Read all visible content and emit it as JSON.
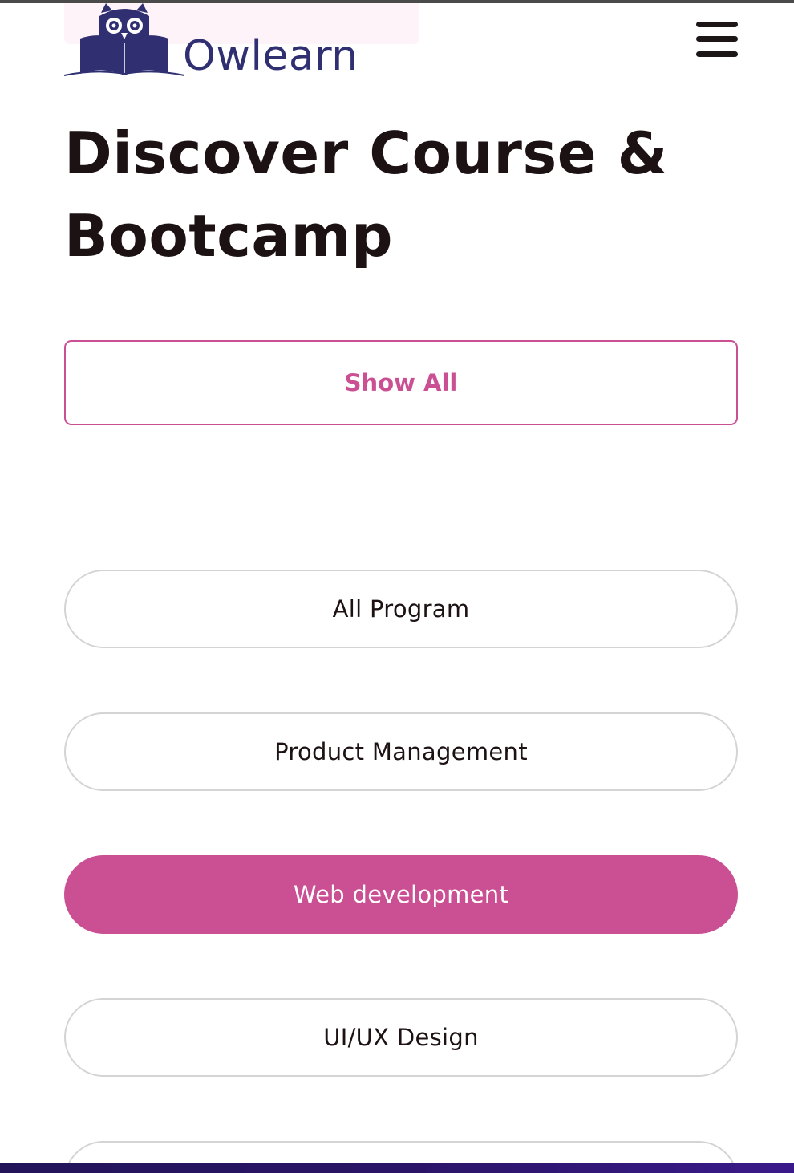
{
  "header": {
    "brand_name": "Owlearn",
    "menu_icon": "hamburger-menu-icon"
  },
  "hero": {
    "title_line1": "Discover Course &",
    "title_line2": "Bootcamp"
  },
  "filters": {
    "show_all_label": "Show All",
    "categories": [
      {
        "label": "All Program",
        "active": false
      },
      {
        "label": "Product Management",
        "active": false
      },
      {
        "label": "Web development",
        "active": true
      },
      {
        "label": "UI/UX Design",
        "active": false
      },
      {
        "label": "",
        "active": false
      }
    ]
  },
  "colors": {
    "accent": "#cb4f93",
    "brand": "#2f2f72",
    "text": "#1d1213",
    "pill_border": "#d4d4d4"
  }
}
